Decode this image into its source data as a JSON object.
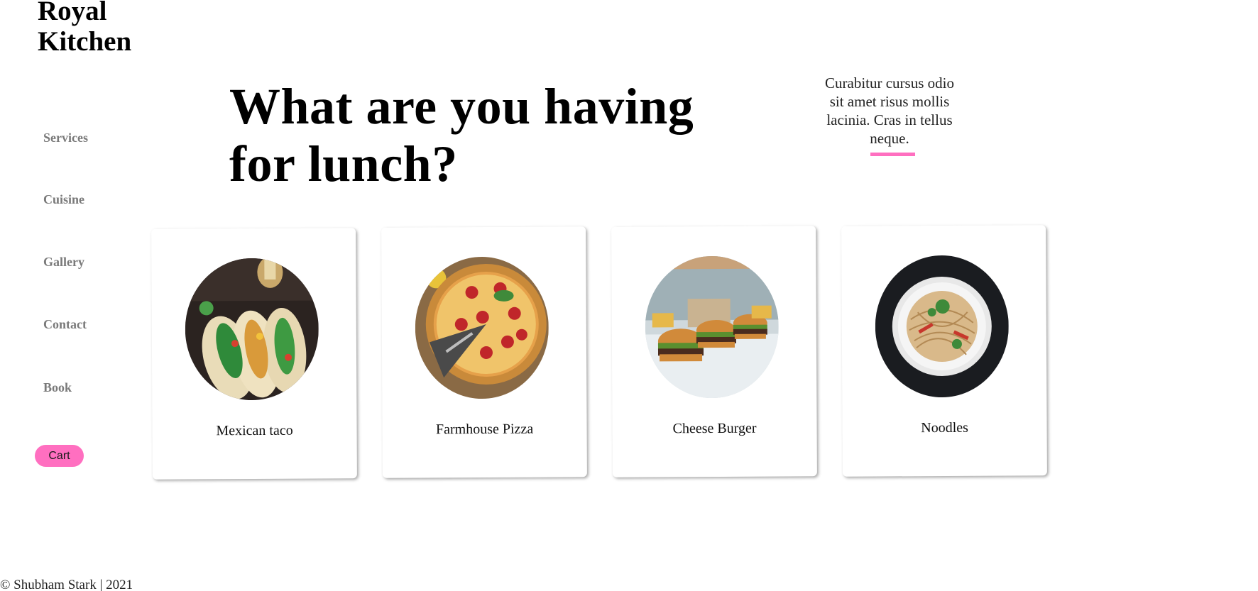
{
  "brand": {
    "line1": "Royal",
    "line2": "Kitchen"
  },
  "nav": {
    "items": [
      {
        "label": "Services"
      },
      {
        "label": "Cuisine"
      },
      {
        "label": "Gallery"
      },
      {
        "label": "Contact"
      },
      {
        "label": "Book"
      }
    ],
    "cart_label": "Cart"
  },
  "hero": {
    "headline": "What are you having for lunch?",
    "blurb": "Curabitur cursus odio sit amet risus mollis lacinia. Cras in tellus neque."
  },
  "dishes": [
    {
      "name": "Mexican taco",
      "image_icon": "taco-photo"
    },
    {
      "name": "Farmhouse Pizza",
      "image_icon": "pizza-photo"
    },
    {
      "name": "Cheese Burger",
      "image_icon": "burger-photo"
    },
    {
      "name": "Noodles",
      "image_icon": "noodles-photo"
    }
  ],
  "footer": {
    "text": "© Shubham Stark | 2021"
  },
  "colors": {
    "accent": "#ff6fc0",
    "nav_text": "#7a7a7a"
  }
}
